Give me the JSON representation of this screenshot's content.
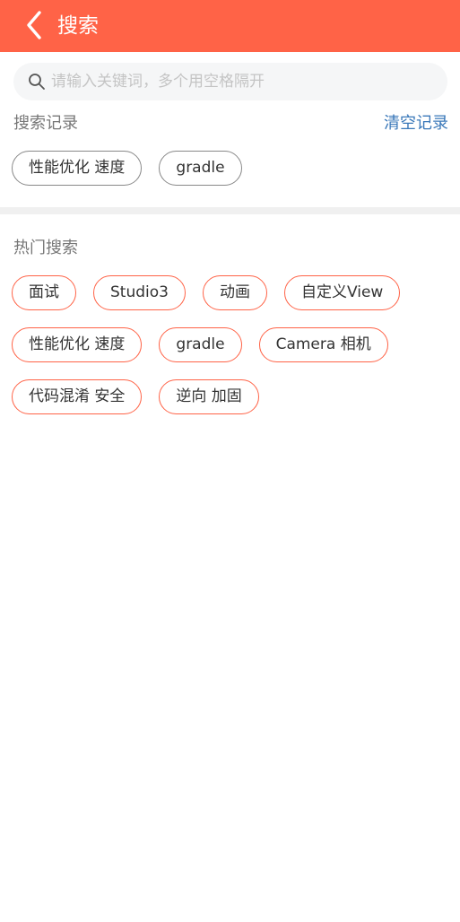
{
  "header": {
    "title": "搜索",
    "back_icon": "chevron-left-icon",
    "background": "#ff6347"
  },
  "search": {
    "placeholder": "请输入关键词，多个用空格隔开",
    "value": "",
    "icon": "search-icon"
  },
  "history": {
    "title": "搜索记录",
    "clear_label": "清空记录",
    "tags": [
      "性能优化 速度",
      "gradle"
    ]
  },
  "hot": {
    "title": "热门搜索",
    "rows": [
      [
        "面试",
        "Studio3",
        "动画",
        "自定义View"
      ],
      [
        "性能优化 速度",
        "gradle",
        "Camera 相机"
      ],
      [
        "代码混淆 安全",
        "逆向 加固"
      ]
    ],
    "accent": "#ff6347"
  }
}
